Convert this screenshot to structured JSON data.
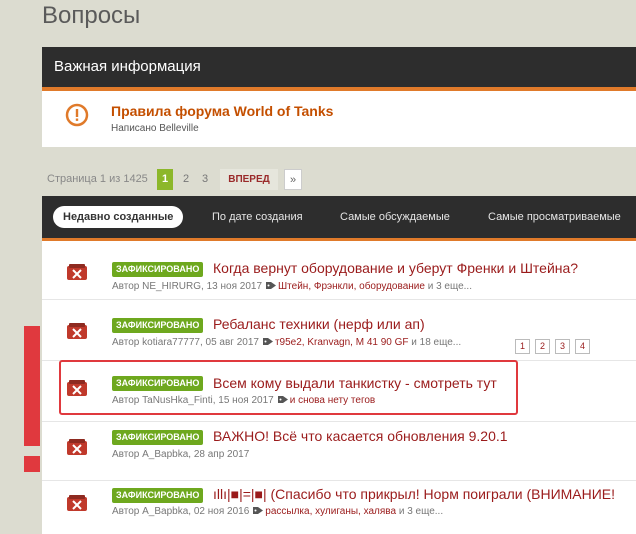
{
  "page": {
    "title": "Вопросы"
  },
  "announcement": {
    "header": "Важная информация",
    "topic_title": "Правила форума World of Tanks",
    "topic_sub": "Написано Belleville"
  },
  "pagination": {
    "label": "Страница 1 из 1425",
    "current": "1",
    "pages": [
      "2",
      "3"
    ],
    "next": "ВПЕРЕД",
    "arrow": "»"
  },
  "tabs": [
    {
      "label": "Недавно созданные"
    },
    {
      "label": "По дате создания"
    },
    {
      "label": "Самые обсуждаемые"
    },
    {
      "label": "Самые просматриваемые"
    }
  ],
  "topics": [
    {
      "badge": "ЗАФИКСИРОВАНО",
      "title": "Когда вернут оборудование и уберут Френки и Штейна?",
      "meta": "Автор NE_HIRURG, 13 ноя 2017",
      "tags": "Штейн, Фрэнкли, оборудование",
      "more": " и 3 еще..."
    },
    {
      "badge": "ЗАФИКСИРОВАНО",
      "title": "Ребаланс техники (нерф или ап)",
      "meta": "Автор kotiara77777, 05 авг 2017",
      "tags": "т95е2, Kranvagn, M 41 90 GF",
      "more": " и 18 еще...",
      "pages": [
        "1",
        "2",
        "3",
        "4"
      ]
    },
    {
      "badge": "ЗАФИКСИРОВАНО",
      "title": "Всем кому выдали танкистку - смотреть тут",
      "meta": "Автор TaNusHka_Finti, 15 ноя 2017",
      "tags": "и снова нету тегов",
      "more": ""
    },
    {
      "badge": "ЗАФИКСИРОВАНО",
      "title": "ВАЖНО! Всё что касается обновления 9.20.1",
      "meta": "Автор A_Bapbka, 28 апр 2017"
    },
    {
      "badge": "ЗАФИКСИРОВАНО",
      "title": "ıllı|■|=|■| (Спасибо что прикрыл! Норм поиграли (ВНИМАНИЕ!",
      "meta": "Автор A_Bapbka, 02 ноя 2016",
      "tags": "рассылка, хулиганы, халява",
      "more": " и 3 еще..."
    }
  ],
  "colors": {
    "accent": "#e07a2a",
    "link": "#9a1b1b",
    "badge": "#6ea81e",
    "annotation": "#e0393e"
  }
}
